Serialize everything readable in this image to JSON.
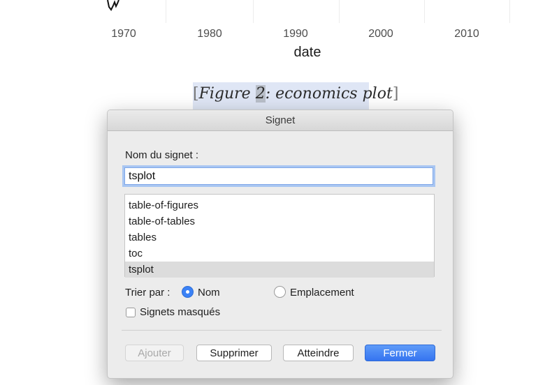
{
  "document": {
    "x_ticks": [
      "1970",
      "1980",
      "1990",
      "2000",
      "2010"
    ],
    "x_axis_title": "date",
    "caption": {
      "open_bracket": "[",
      "prefix": "Figure ",
      "number": "2",
      "suffix": ": economics plot",
      "close_bracket": "]"
    }
  },
  "dialog": {
    "title": "Signet",
    "name_label": "Nom du signet :",
    "name_value": "tsplot",
    "bookmarks": [
      "table-of-figures",
      "table-of-tables",
      "tables",
      "toc",
      "tsplot"
    ],
    "selected_bookmark": "tsplot",
    "sort_label": "Trier par :",
    "sort_options": [
      {
        "label": "Nom",
        "selected": true
      },
      {
        "label": "Emplacement",
        "selected": false
      }
    ],
    "hidden_bookmarks_label": "Signets masqués",
    "hidden_bookmarks_checked": false,
    "buttons": {
      "add": "Ajouter",
      "delete": "Supprimer",
      "goto": "Atteindre",
      "close": "Fermer"
    }
  },
  "colors": {
    "accent": "#3b82f6",
    "caption_highlight": "#dfe6f5"
  }
}
